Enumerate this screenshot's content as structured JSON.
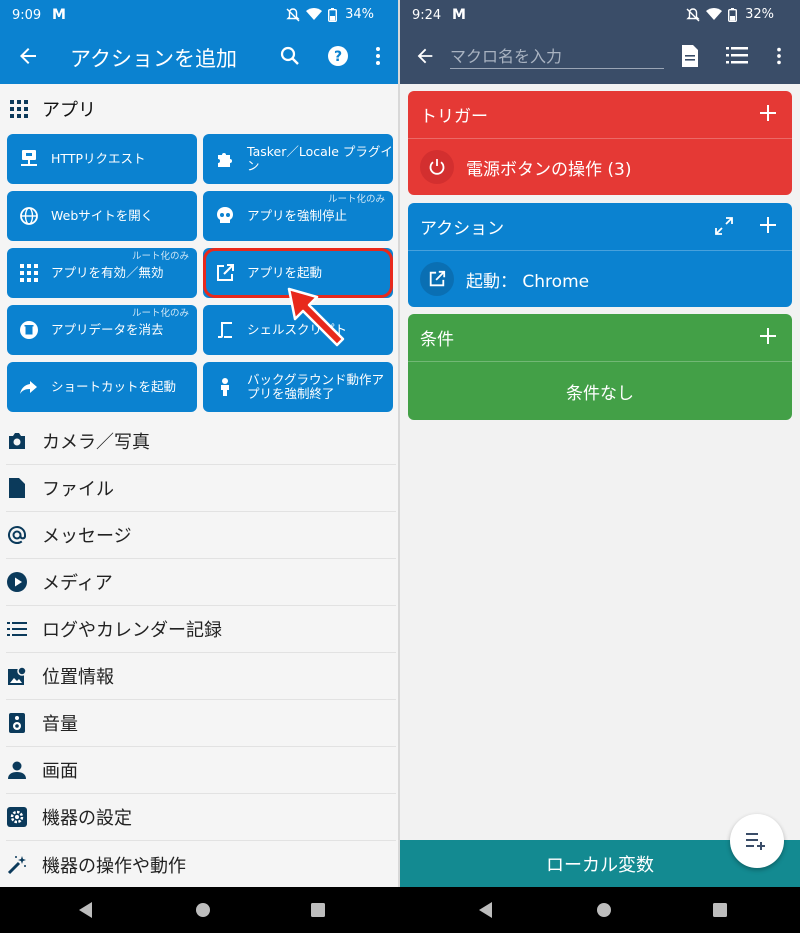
{
  "left": {
    "status": {
      "time": "9:09",
      "app_logo": "M",
      "battery": "34%"
    },
    "appbar": {
      "title": "アクションを追加"
    },
    "section": {
      "title": "アプリ"
    },
    "tiles": [
      {
        "label": "HTTPリクエスト",
        "icon": "network-icon"
      },
      {
        "label": "Tasker／Locale プラグイン",
        "icon": "puzzle-icon"
      },
      {
        "label": "Webサイトを開く",
        "icon": "globe-icon"
      },
      {
        "label": "アプリを強制停止",
        "icon": "skull-icon",
        "badge": "ルート化のみ"
      },
      {
        "label": "アプリを有効／無効",
        "icon": "grid-icon",
        "badge": "ルート化のみ"
      },
      {
        "label": "アプリを起動",
        "icon": "open-in-new-icon"
      },
      {
        "label": "アプリデータを消去",
        "icon": "trash-icon",
        "badge": "ルート化のみ"
      },
      {
        "label": "シェルスクリプト",
        "icon": "script-icon"
      },
      {
        "label": "ショートカットを起動",
        "icon": "share-arrow-icon"
      },
      {
        "label": "バックグラウンド動作アプリを強制終了",
        "icon": "person-icon"
      }
    ],
    "categories": [
      {
        "label": "カメラ／写真",
        "icon": "camera-icon"
      },
      {
        "label": "ファイル",
        "icon": "file-icon"
      },
      {
        "label": "メッセージ",
        "icon": "at-icon"
      },
      {
        "label": "メディア",
        "icon": "play-icon"
      },
      {
        "label": "ログやカレンダー記録",
        "icon": "list-icon"
      },
      {
        "label": "位置情報",
        "icon": "map-icon"
      },
      {
        "label": "音量",
        "icon": "speaker-icon"
      },
      {
        "label": "画面",
        "icon": "person-icon"
      },
      {
        "label": "機器の設定",
        "icon": "settings-icon"
      },
      {
        "label": "機器の操作や動作",
        "icon": "magic-wand-icon"
      }
    ]
  },
  "right": {
    "status": {
      "time": "9:24",
      "app_logo": "M",
      "battery": "32%"
    },
    "appbar": {
      "macro_placeholder": "マクロ名を入力"
    },
    "trigger": {
      "title": "トリガー",
      "item": "電源ボタンの操作 (3)",
      "color": "#e53935"
    },
    "action": {
      "title": "アクション",
      "item": "起動： Chrome",
      "color": "#0b82d0"
    },
    "condition": {
      "title": "条件",
      "item": "条件なし",
      "color": "#43a047"
    },
    "local_vars": "ローカル変数"
  }
}
